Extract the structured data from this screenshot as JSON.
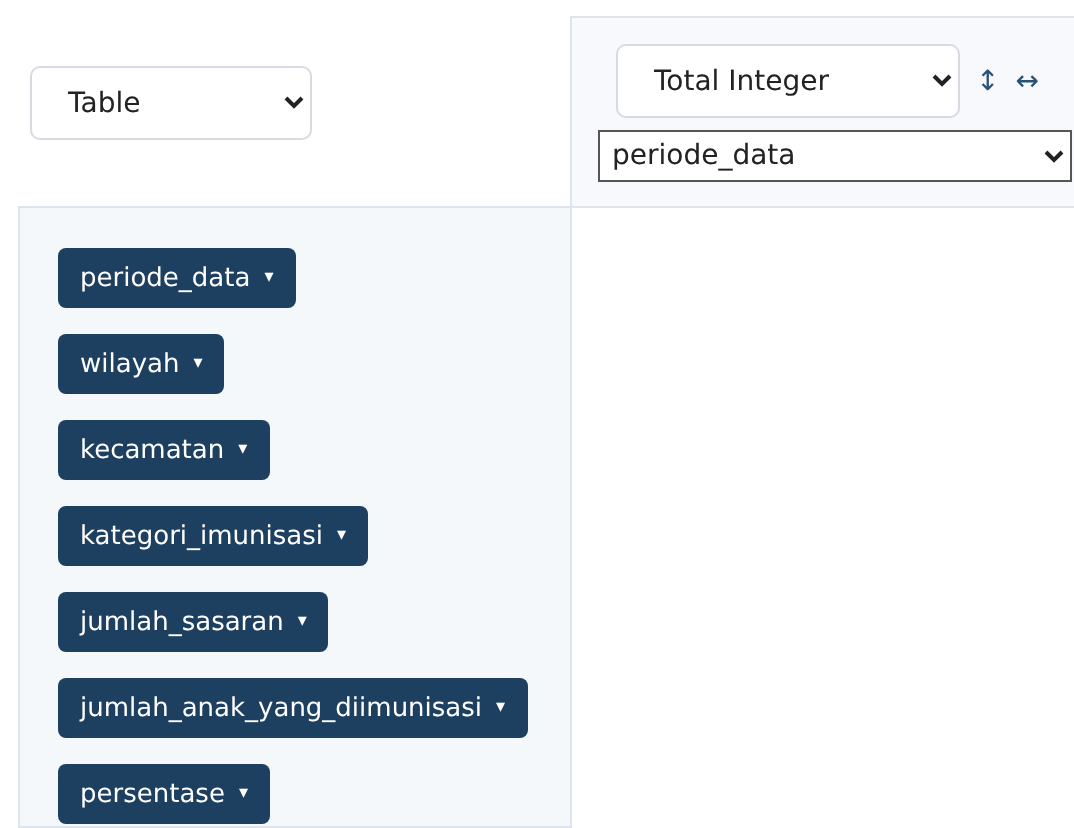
{
  "renderer_select": {
    "value": "Table"
  },
  "aggregator": {
    "select": {
      "value": "Total Integer"
    },
    "row_order_toggle": "↕",
    "col_order_toggle": "↔",
    "attribute_select": {
      "value": "periode_data"
    }
  },
  "attributes": [
    {
      "label": "periode_data",
      "caret": "▾"
    },
    {
      "label": "wilayah",
      "caret": "▾"
    },
    {
      "label": "kecamatan",
      "caret": "▾"
    },
    {
      "label": "kategori_imunisasi",
      "caret": "▾"
    },
    {
      "label": "jumlah_sasaran",
      "caret": "▾"
    },
    {
      "label": "jumlah_anak_yang_diimunisasi",
      "caret": "▾"
    },
    {
      "label": "persentase",
      "caret": "▾"
    }
  ]
}
